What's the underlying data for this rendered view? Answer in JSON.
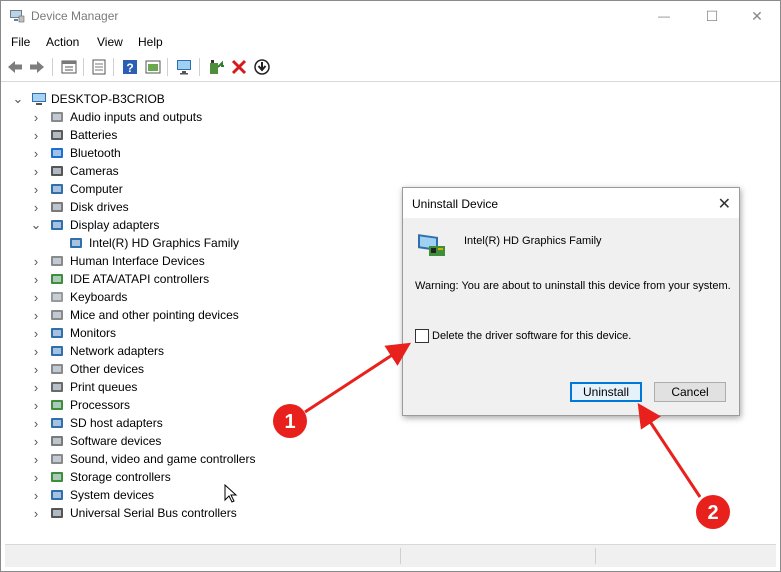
{
  "window": {
    "title": "Device Manager",
    "controls": {
      "minimize": "—",
      "maximize": "☐",
      "close": "✕"
    }
  },
  "menu": [
    "File",
    "Action",
    "View",
    "Help"
  ],
  "toolbar": {
    "icons": [
      "back-icon",
      "forward-icon",
      "properties-sheet-icon",
      "show-hidden-icon",
      "help-icon",
      "update-view-icon",
      "monitor-icon",
      "update-driver-icon",
      "uninstall-icon",
      "download-icon"
    ]
  },
  "tree": {
    "root": "DESKTOP-B3CRIOB",
    "items": [
      {
        "label": "Audio inputs and outputs",
        "icon": "speaker-icon",
        "expanded": false
      },
      {
        "label": "Batteries",
        "icon": "battery-icon",
        "expanded": false
      },
      {
        "label": "Bluetooth",
        "icon": "bluetooth-icon",
        "expanded": false
      },
      {
        "label": "Cameras",
        "icon": "camera-icon",
        "expanded": false
      },
      {
        "label": "Computer",
        "icon": "computer-icon",
        "expanded": false
      },
      {
        "label": "Disk drives",
        "icon": "disk-drive-icon",
        "expanded": false
      },
      {
        "label": "Display adapters",
        "icon": "display-adapter-icon",
        "expanded": true
      },
      {
        "label": "Intel(R) HD Graphics Family",
        "icon": "display-adapter-icon",
        "child": true
      },
      {
        "label": "Human Interface Devices",
        "icon": "hid-icon",
        "expanded": false
      },
      {
        "label": "IDE ATA/ATAPI controllers",
        "icon": "ide-controller-icon",
        "expanded": false
      },
      {
        "label": "Keyboards",
        "icon": "keyboard-icon",
        "expanded": false
      },
      {
        "label": "Mice and other pointing devices",
        "icon": "mouse-icon",
        "expanded": false
      },
      {
        "label": "Monitors",
        "icon": "monitor-icon",
        "expanded": false
      },
      {
        "label": "Network adapters",
        "icon": "network-adapter-icon",
        "expanded": false
      },
      {
        "label": "Other devices",
        "icon": "other-devices-icon",
        "expanded": false
      },
      {
        "label": "Print queues",
        "icon": "printer-icon",
        "expanded": false
      },
      {
        "label": "Processors",
        "icon": "processor-icon",
        "expanded": false
      },
      {
        "label": "SD host adapters",
        "icon": "sd-card-icon",
        "expanded": false
      },
      {
        "label": "Software devices",
        "icon": "software-device-icon",
        "expanded": false
      },
      {
        "label": "Sound, video and game controllers",
        "icon": "sound-icon",
        "expanded": false
      },
      {
        "label": "Storage controllers",
        "icon": "storage-controller-icon",
        "expanded": false
      },
      {
        "label": "System devices",
        "icon": "system-device-icon",
        "expanded": false
      },
      {
        "label": "Universal Serial Bus controllers",
        "icon": "usb-icon",
        "expanded": false
      }
    ]
  },
  "dialog": {
    "title": "Uninstall Device",
    "device_name": "Intel(R) HD Graphics Family",
    "warning": "Warning: You are about to uninstall this device from your system.",
    "checkbox_label": "Delete the driver software for this device.",
    "checkbox_checked": false,
    "uninstall_label": "Uninstall",
    "cancel_label": "Cancel"
  },
  "annotations": [
    {
      "number": "1",
      "color": "#e8211c"
    },
    {
      "number": "2",
      "color": "#e8211c"
    }
  ]
}
